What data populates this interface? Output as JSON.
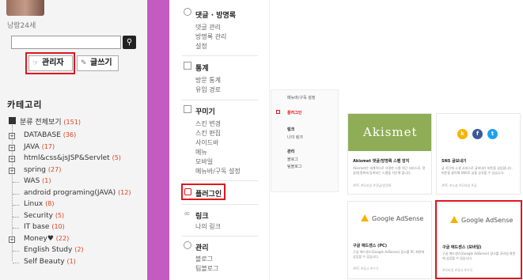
{
  "blog": {
    "nickname": "낭랑24세",
    "search_placeholder": "",
    "search_icon": "magnifier-icon",
    "admin_label": "관리자",
    "write_label": "글쓰기",
    "category_title": "카테고리",
    "all_label": "분류 전체보기",
    "all_count": "(151)",
    "categories": [
      {
        "label": "DATABASE",
        "count": "(36)"
      },
      {
        "label": "JAVA",
        "count": "(17)"
      },
      {
        "label": "html&css&jsJSP&Servlet",
        "count": "(5)"
      },
      {
        "label": "spring",
        "count": "(27)"
      },
      {
        "label": "WAS",
        "count": "(1)"
      },
      {
        "label": "android programing(JAVA)",
        "count": "(12)"
      },
      {
        "label": "Linux",
        "count": "(8)"
      },
      {
        "label": "Security",
        "count": "(5)"
      },
      {
        "label": "IT base",
        "count": "(10)"
      },
      {
        "label": "Money♥",
        "count": "(22)"
      },
      {
        "label": "English Study",
        "count": "(2)"
      },
      {
        "label": "Self Beauty",
        "count": "(1)"
      }
    ]
  },
  "menu": {
    "comments": {
      "title": "댓글 · 방명록",
      "items": [
        "댓글 관리",
        "방명록 관리",
        "설정"
      ]
    },
    "stats": {
      "title": "통계",
      "items": [
        "방문 통계",
        "유입 경로"
      ]
    },
    "design": {
      "title": "꾸미기",
      "items": [
        "스킨 변경",
        "스킨 편집",
        "사이드바",
        "메뉴",
        "모바일",
        "메뉴바/구독 설정"
      ]
    },
    "plugin": {
      "title": "플러그인"
    },
    "link": {
      "title": "링크",
      "items": [
        "나의 링크"
      ]
    },
    "admin": {
      "title": "관리",
      "items": [
        "블로그",
        "팀블로그"
      ]
    }
  },
  "mini": {
    "top": "메뉴바/구독 설정",
    "plugin": "플러그인",
    "link": "링크",
    "link_sub": "나의 링크",
    "admin": "관리",
    "admin_items": [
      "블로그",
      "팀블로그"
    ]
  },
  "cards": [
    {
      "logo": "Akismet",
      "title": "Akismet 댓글/방명록 스팸 방지",
      "desc": "Akismet은 세계적으로 유명한 스팸 차단 서비스로, 댓글/방명록에 등록되는 스팸을 차단해 줍니다.",
      "tags": "#PC  #모바일  #댓글/방명록"
    },
    {
      "logo": "SNS",
      "title": "SNS 글보내기",
      "desc": "글 하단에 소셜 서비스로 글보내기 버튼을 삽입합니다. 버튼을 클릭해 SNS로 글을 공유할 수 있습니다.",
      "tags": "#PC  #소셜  #모바일  #글"
    },
    {
      "logo": "Google AdSense",
      "title": "구글 애드센스 (PC)",
      "desc": "구글 애드센스(Google AdSense) 광고를 PC 화면에 삽입할 수 있습니다.",
      "tags": "#PC  #광고  #수익"
    },
    {
      "logo": "Google AdSense",
      "title": "구글 애드센스 (모바일)",
      "desc": "구글 애드센스(Google AdSense) 광고를 모바일 화면에 삽입할 수 있습니다.",
      "tags": "#모바일  #광고  #수익"
    }
  ],
  "colors": {
    "accent_red": "#e0161f",
    "divider": "#c45bc1",
    "akismet_green": "#8fad57",
    "count_orange": "#e0401c"
  }
}
